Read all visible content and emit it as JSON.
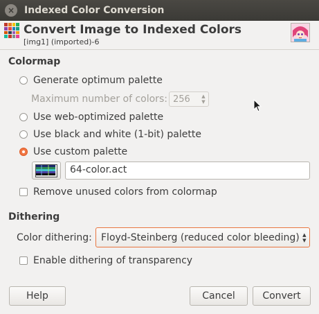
{
  "window": {
    "title": "Indexed Color Conversion",
    "close_glyph": "×"
  },
  "header": {
    "title": "Convert Image to Indexed Colors",
    "subtitle": "[img1] (imported)-6"
  },
  "colormap": {
    "section_label": "Colormap",
    "options": [
      {
        "label": "Generate optimum palette",
        "checked": false
      },
      {
        "label": "Use web-optimized palette",
        "checked": false
      },
      {
        "label": "Use black and white (1-bit) palette",
        "checked": false
      },
      {
        "label": "Use custom palette",
        "checked": true
      }
    ],
    "max_colors_label": "Maximum number of colors:",
    "max_colors_value": "256",
    "custom_palette_name": "64-color.act",
    "remove_unused_label": "Remove unused colors from colormap",
    "remove_unused_checked": false
  },
  "dithering": {
    "section_label": "Dithering",
    "color_dithering_label": "Color dithering:",
    "color_dithering_value": "Floyd-Steinberg (reduced color bleeding)",
    "transparency_label": "Enable dithering of transparency",
    "transparency_checked": false
  },
  "buttons": {
    "help": "Help",
    "cancel": "Cancel",
    "convert": "Convert"
  },
  "colors": {
    "accent": "#f07746",
    "titlebar": "#3b3a36",
    "background": "#f2f1f0"
  }
}
